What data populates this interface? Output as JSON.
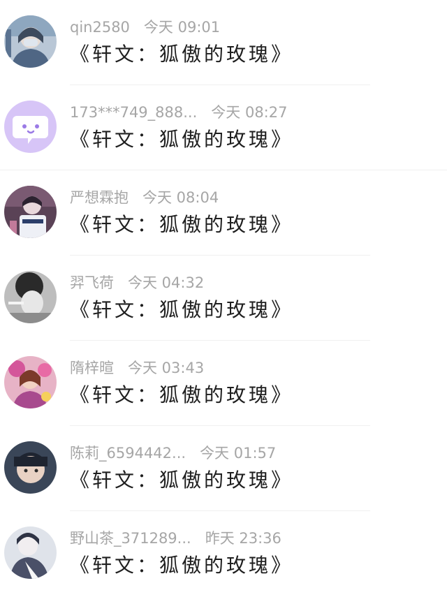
{
  "comments": [
    {
      "username": "qin2580",
      "time": "今天 09:01",
      "text": "《轩文：狐傲的玫瑰》",
      "avatar_icon": "user-photo-avatar"
    },
    {
      "username": "173***749_888...",
      "time": "今天 08:27",
      "text": "《轩文：狐傲的玫瑰》",
      "avatar_icon": "chat-bubble-default-avatar",
      "avatar_color": "#d7c5f7"
    },
    {
      "username": "严想霖抱",
      "time": "今天 08:04",
      "text": "《轩文：狐傲的玫瑰》",
      "avatar_icon": "user-photo-avatar"
    },
    {
      "username": "羿飞荷",
      "time": "今天 04:32",
      "text": "《轩文：狐傲的玫瑰》",
      "avatar_icon": "user-photo-avatar"
    },
    {
      "username": "隋梓暄",
      "time": "今天 03:43",
      "text": "《轩文：狐傲的玫瑰》",
      "avatar_icon": "user-photo-avatar"
    },
    {
      "username": "陈莉_6594442...",
      "time": "今天 01:57",
      "text": "《轩文：狐傲的玫瑰》",
      "avatar_icon": "user-photo-avatar"
    },
    {
      "username": "野山茶_371289...",
      "time": "昨天 23:36",
      "text": "《轩文：狐傲的玫瑰》",
      "avatar_icon": "user-photo-avatar"
    }
  ],
  "colors": {
    "meta_text": "#a6a6a6",
    "comment_text": "#1f1f1f",
    "divider": "#f0f0f0",
    "default_avatar_bg": "#d7c5f7"
  }
}
